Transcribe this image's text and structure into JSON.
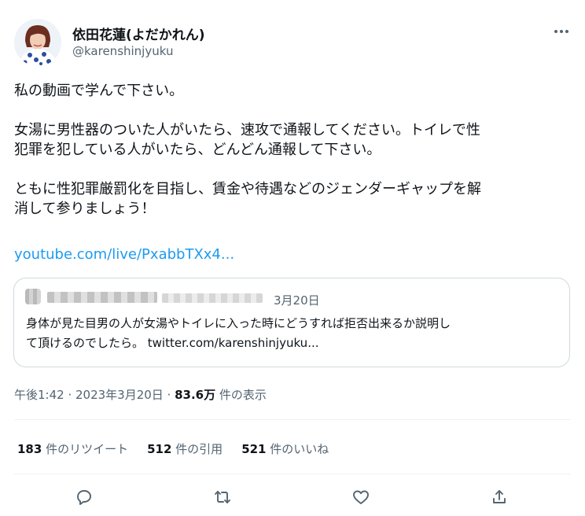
{
  "author": {
    "display_name": "依田花蓮(よだかれん)",
    "handle": "@karenshinjyuku"
  },
  "icons": {
    "more": "more-horizontal-icon",
    "reply": "reply-icon",
    "retweet": "retweet-icon",
    "like": "like-icon",
    "share": "share-icon"
  },
  "tweet": {
    "lines": [
      "私の動画で学んで下さい。",
      "",
      "女湯に男性器のついた人がいたら、速攻で通報してください。トイレで性",
      "犯罪を犯している人がいたら、どんどん通報して下さい。",
      "",
      "ともに性犯罪厳罰化を目指し、賃金や待遇などのジェンダーギャップを解",
      "消して参りましょう！"
    ],
    "link": "youtube.com/live/PxabbTXx4..."
  },
  "quote": {
    "date": "3月20日",
    "text_line1": "身体が見た目男の人が女湯やトイレに入った時にどうすれば拒否出来るか説明し",
    "text_line2": "て頂けるのでしたら。 twitter.com/karenshinjyuku..."
  },
  "meta": {
    "time_date": "午後1:42 · 2023年3月20日 · ",
    "views": "83.6万",
    "views_suffix": " 件の表示"
  },
  "stats": {
    "retweets_count": "183",
    "retweets_label": " 件のリツイート",
    "quotes_count": "512",
    "quotes_label": " 件の引用",
    "likes_count": "521",
    "likes_label": " 件のいいね"
  },
  "colors": {
    "text": "#0f1419",
    "secondary": "#536471",
    "link": "#1d9bf0",
    "border": "#cfd9de",
    "divider": "#eff3f4"
  }
}
